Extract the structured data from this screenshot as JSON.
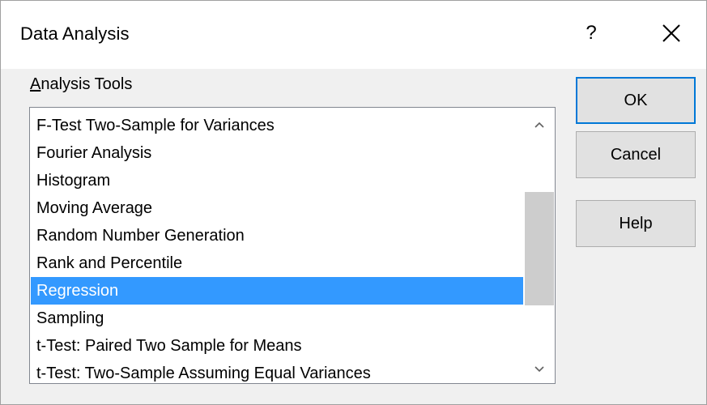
{
  "dialog": {
    "title": "Data Analysis",
    "help_glyph": "?"
  },
  "analysis_tools": {
    "label_accesskey": "A",
    "label_rest": "nalysis Tools",
    "items": [
      "F-Test Two-Sample for Variances",
      "Fourier Analysis",
      "Histogram",
      "Moving Average",
      "Random Number Generation",
      "Rank and Percentile",
      "Regression",
      "Sampling",
      "t-Test: Paired Two Sample for Means",
      "t-Test: Two-Sample Assuming Equal Variances"
    ],
    "selected": "Regression",
    "scroll_position": 0.53
  },
  "buttons": {
    "ok": "OK",
    "cancel": "Cancel",
    "help_accesskey": "H",
    "help_rest": "elp"
  },
  "icons": {
    "close": "close-icon",
    "scroll_up": "chevron-up-icon",
    "scroll_down": "chevron-down-icon"
  },
  "colors": {
    "selection": "#3399ff",
    "default_button_border": "#0078d7"
  }
}
